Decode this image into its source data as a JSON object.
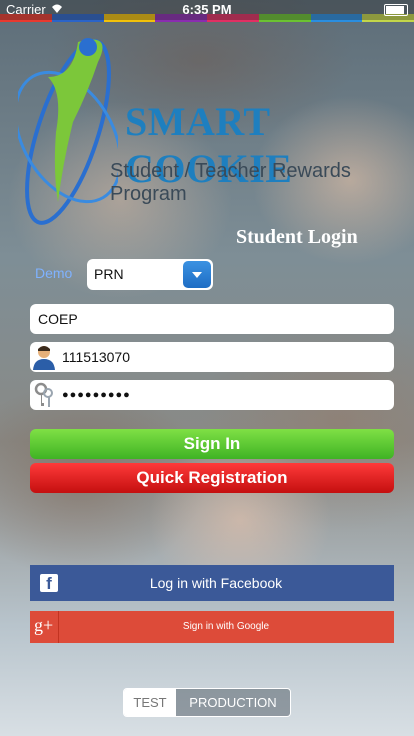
{
  "status_bar": {
    "carrier": "Carrier",
    "time": "6:35 PM"
  },
  "colors": {
    "strip": [
      "#e8392f",
      "#2b64c8",
      "#f2c10a",
      "#8a2db0",
      "#e12f63",
      "#6bc232",
      "#2a8ee0",
      "#c3d64a"
    ],
    "brand": "#1e7fbf",
    "sign_in": "#4dbb2a",
    "quick": "#d81515",
    "facebook": "#3b5998",
    "google": "#dd4b39"
  },
  "branding": {
    "name": "SMART COOKIE",
    "tagline": "Student / Teacher Rewards Program"
  },
  "page_title": "Student Login",
  "form": {
    "demo_label": "Demo",
    "id_type_selected": "PRN",
    "institute_value": "COEP",
    "prn_value": "111513070",
    "password_value": "●●●●●●●●●"
  },
  "buttons": {
    "sign_in": "Sign In",
    "quick_registration": "Quick Registration",
    "facebook": "Log in with Facebook",
    "google": "Sign in with Google"
  },
  "environment": {
    "options": [
      "TEST",
      "PRODUCTION"
    ],
    "selected": "PRODUCTION"
  },
  "icons": [
    "wifi-icon",
    "battery-icon",
    "user-icon",
    "key-icon",
    "facebook-icon",
    "google-plus-icon",
    "dropdown-arrow-icon"
  ]
}
